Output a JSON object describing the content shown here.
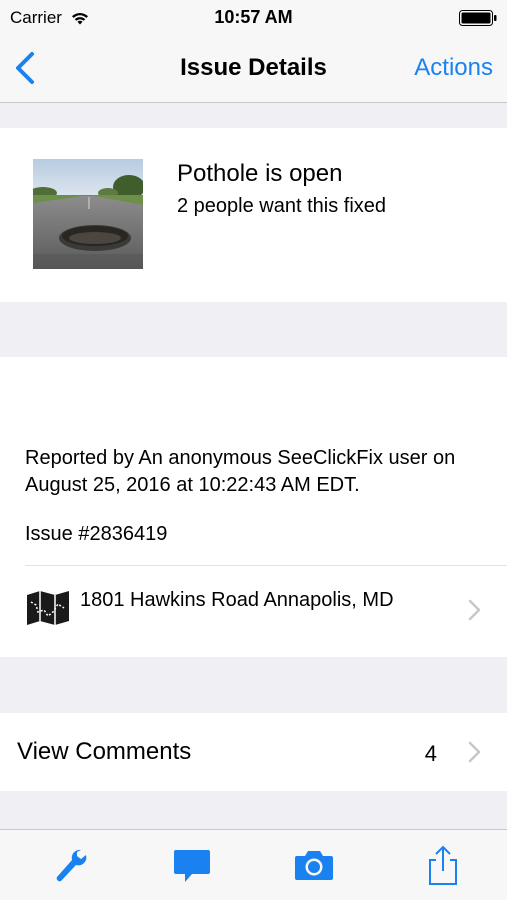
{
  "status_bar": {
    "carrier": "Carrier",
    "time": "10:57 AM"
  },
  "nav": {
    "title": "Issue Details",
    "actions_label": "Actions",
    "accent_color": "#1a82f0"
  },
  "summary": {
    "status": "Pothole is open",
    "want_fixed": "2 people want this fixed",
    "thumbnail": "pothole-photo"
  },
  "details": {
    "reported": "Reported by An anonymous SeeClickFix user on August 25, 2016 at 10:22:43 AM EDT.",
    "issue_number": "Issue #2836419",
    "address": "1801 Hawkins Road Annapolis, MD"
  },
  "comments": {
    "label": "View Comments",
    "count": "4"
  },
  "tab_bar": {
    "icons": [
      "wrench-icon",
      "comment-icon",
      "camera-icon",
      "share-icon"
    ]
  }
}
